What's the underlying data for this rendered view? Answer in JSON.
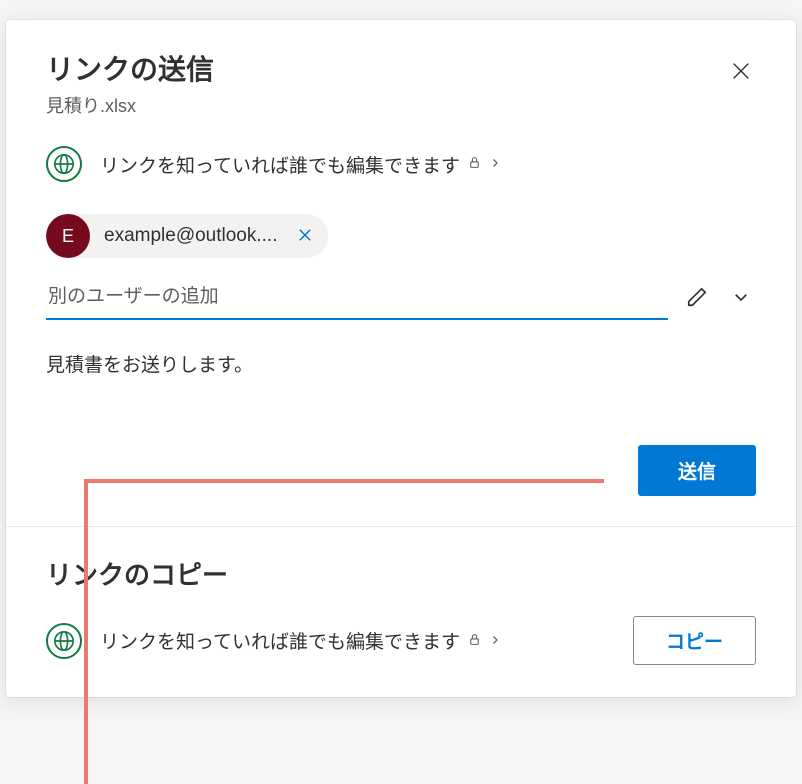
{
  "dialog": {
    "title": "リンクの送信",
    "file_name": "見積り.xlsx"
  },
  "link_setting": {
    "text": "リンクを知っていれば誰でも編集できます"
  },
  "recipients": [
    {
      "initial": "E",
      "email": "example@outlook...."
    }
  ],
  "add_user": {
    "placeholder": "別のユーザーの追加"
  },
  "message": {
    "value": "見積書をお送りします。"
  },
  "actions": {
    "send": "送信",
    "copy": "コピー"
  },
  "copy_section": {
    "title": "リンクのコピー",
    "text": "リンクを知っていれば誰でも編集できます"
  }
}
